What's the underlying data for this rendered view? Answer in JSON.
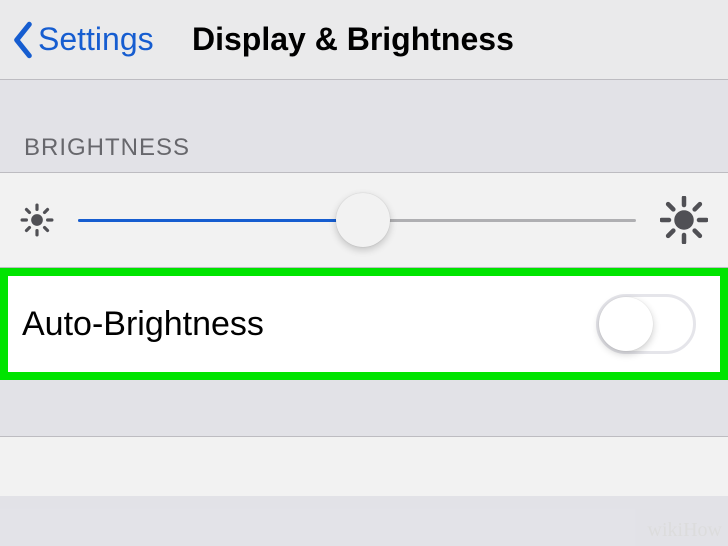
{
  "nav": {
    "back_label": "Settings",
    "title": "Display & Brightness"
  },
  "brightness": {
    "section_header": "BRIGHTNESS",
    "slider_percent": 51,
    "auto_label": "Auto-Brightness",
    "auto_enabled": false
  },
  "watermark": "wikiHow"
}
